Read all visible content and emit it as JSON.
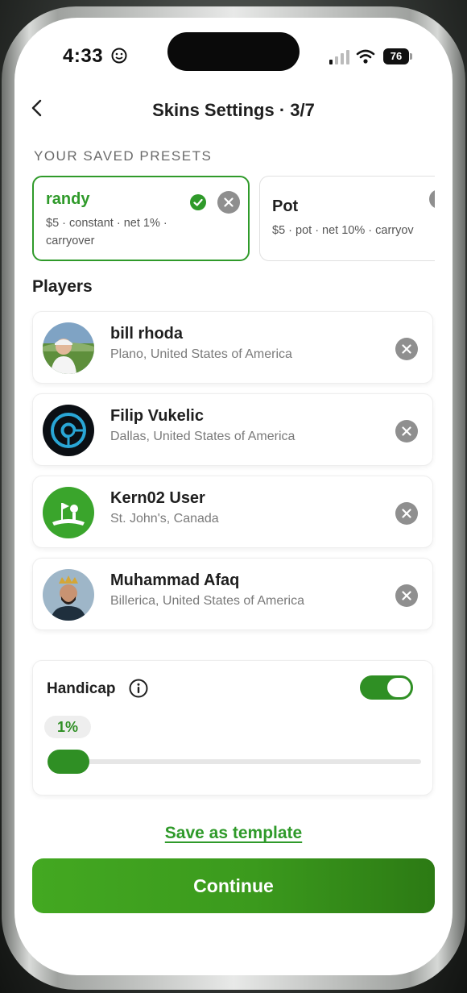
{
  "status_bar": {
    "time": "4:33",
    "battery": "76"
  },
  "nav": {
    "title": "Skins Settings · 3/7"
  },
  "presets": {
    "section_label": "YOUR SAVED PRESETS",
    "items": [
      {
        "name": "randy",
        "description": "$5 · constant · net 1% · carryover",
        "selected": true
      },
      {
        "name": "Pot",
        "description": "$5 · pot · net 10% · carryov",
        "selected": false
      }
    ]
  },
  "players": {
    "title": "Players",
    "items": [
      {
        "name": "bill rhoda",
        "location": "Plano, United States of America",
        "avatar": "golfer-photo"
      },
      {
        "name": "Filip Vukelic",
        "location": "Dallas, United States of America",
        "avatar": "swirl-logo"
      },
      {
        "name": "Kern02 User",
        "location": "St. John's, Canada",
        "avatar": "golf-course-icon"
      },
      {
        "name": "Muhammad Afaq",
        "location": "Billerica, United States of America",
        "avatar": "person-photo"
      }
    ]
  },
  "handicap": {
    "label": "Handicap",
    "enabled": true,
    "value_label": "1%",
    "value_fraction": 0.01
  },
  "actions": {
    "save_template": "Save as template",
    "continue": "Continue"
  },
  "colors": {
    "accent": "#2f9a2a",
    "accent_dark": "#2c7a14",
    "muted_text": "#7a7a7a"
  }
}
